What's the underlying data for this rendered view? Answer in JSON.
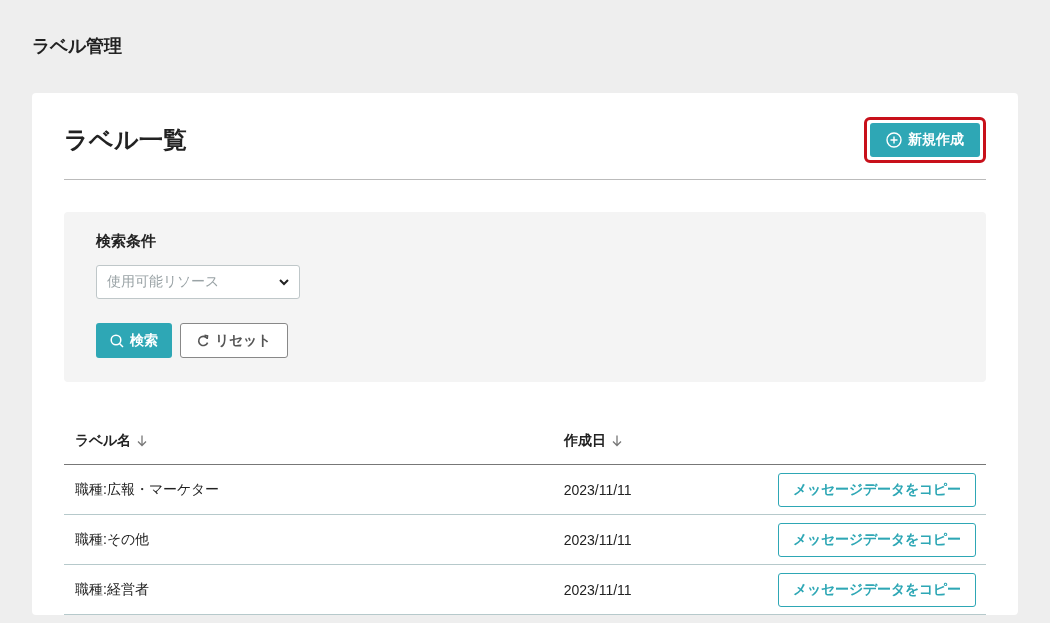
{
  "page_title": "ラベル管理",
  "card": {
    "title": "ラベル一覧",
    "new_button": {
      "label": "新規作成",
      "highlighted": true
    }
  },
  "search": {
    "title": "検索条件",
    "resource_select": {
      "placeholder": "使用可能リソース"
    },
    "buttons": [
      {
        "kind": "primary",
        "label": "検索"
      },
      {
        "kind": "reset",
        "label": "リセット"
      }
    ]
  },
  "table": {
    "columns": [
      {
        "label": "ラベル名",
        "sortable": true
      },
      {
        "label": "作成日",
        "sortable": true
      }
    ],
    "rows": [
      {
        "name": "職種:広報・マーケター",
        "created": "2023/11/11",
        "action": "メッセージデータをコピー"
      },
      {
        "name": "職種:その他",
        "created": "2023/11/11",
        "action": "メッセージデータをコピー"
      },
      {
        "name": "職種:経営者",
        "created": "2023/11/11",
        "action": "メッセージデータをコピー"
      }
    ]
  }
}
